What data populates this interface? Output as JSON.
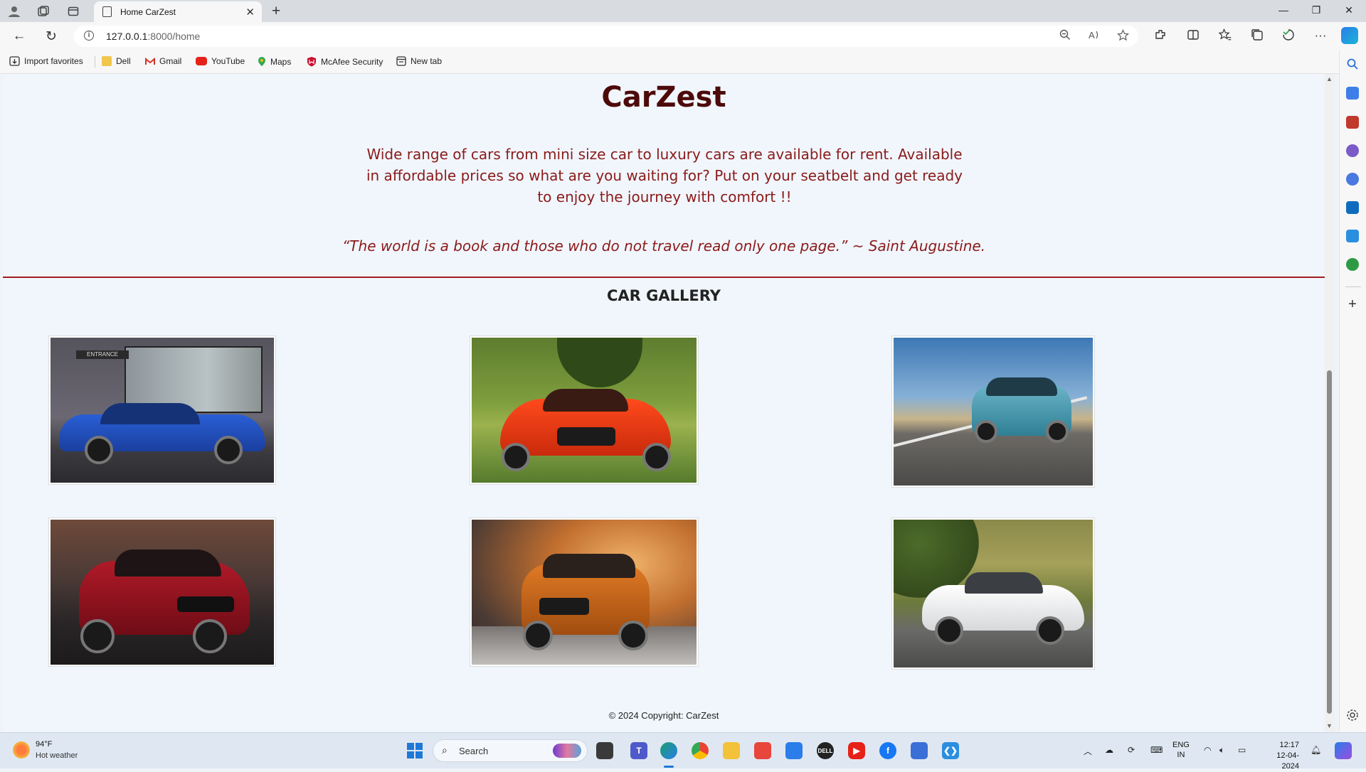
{
  "browser": {
    "tab_title": "Home CarZest",
    "url_host": "127.0.0.1",
    "url_rest": ":8000/home",
    "bookmarks": [
      "Import favorites",
      "Dell",
      "Gmail",
      "YouTube",
      "Maps",
      "McAfee Security",
      "New tab"
    ]
  },
  "site": {
    "title": "CarZest",
    "intro": "Wide range of cars from mini size car to luxury cars are available for rent. Available in affordable prices so what are you waiting for? Put on your seatbelt and get ready to enjoy the journey with comfort !!",
    "quote": "“The world is a book and those who do not travel read only one page.” ~ Saint Augustine.",
    "gallery_title": "CAR GALLERY",
    "footer": "© 2024 Copyright: CarZest"
  },
  "colors": {
    "title": "#4d0a0a",
    "accent": "#8b1a1a",
    "divider": "#a11d1d",
    "page_bg": "#f0f6fc"
  },
  "taskbar": {
    "temperature": "94°F",
    "weather": "Hot weather",
    "search_placeholder": "Search",
    "lang_1": "ENG",
    "lang_2": "IN",
    "time": "12:17",
    "date": "12-04-2024"
  }
}
